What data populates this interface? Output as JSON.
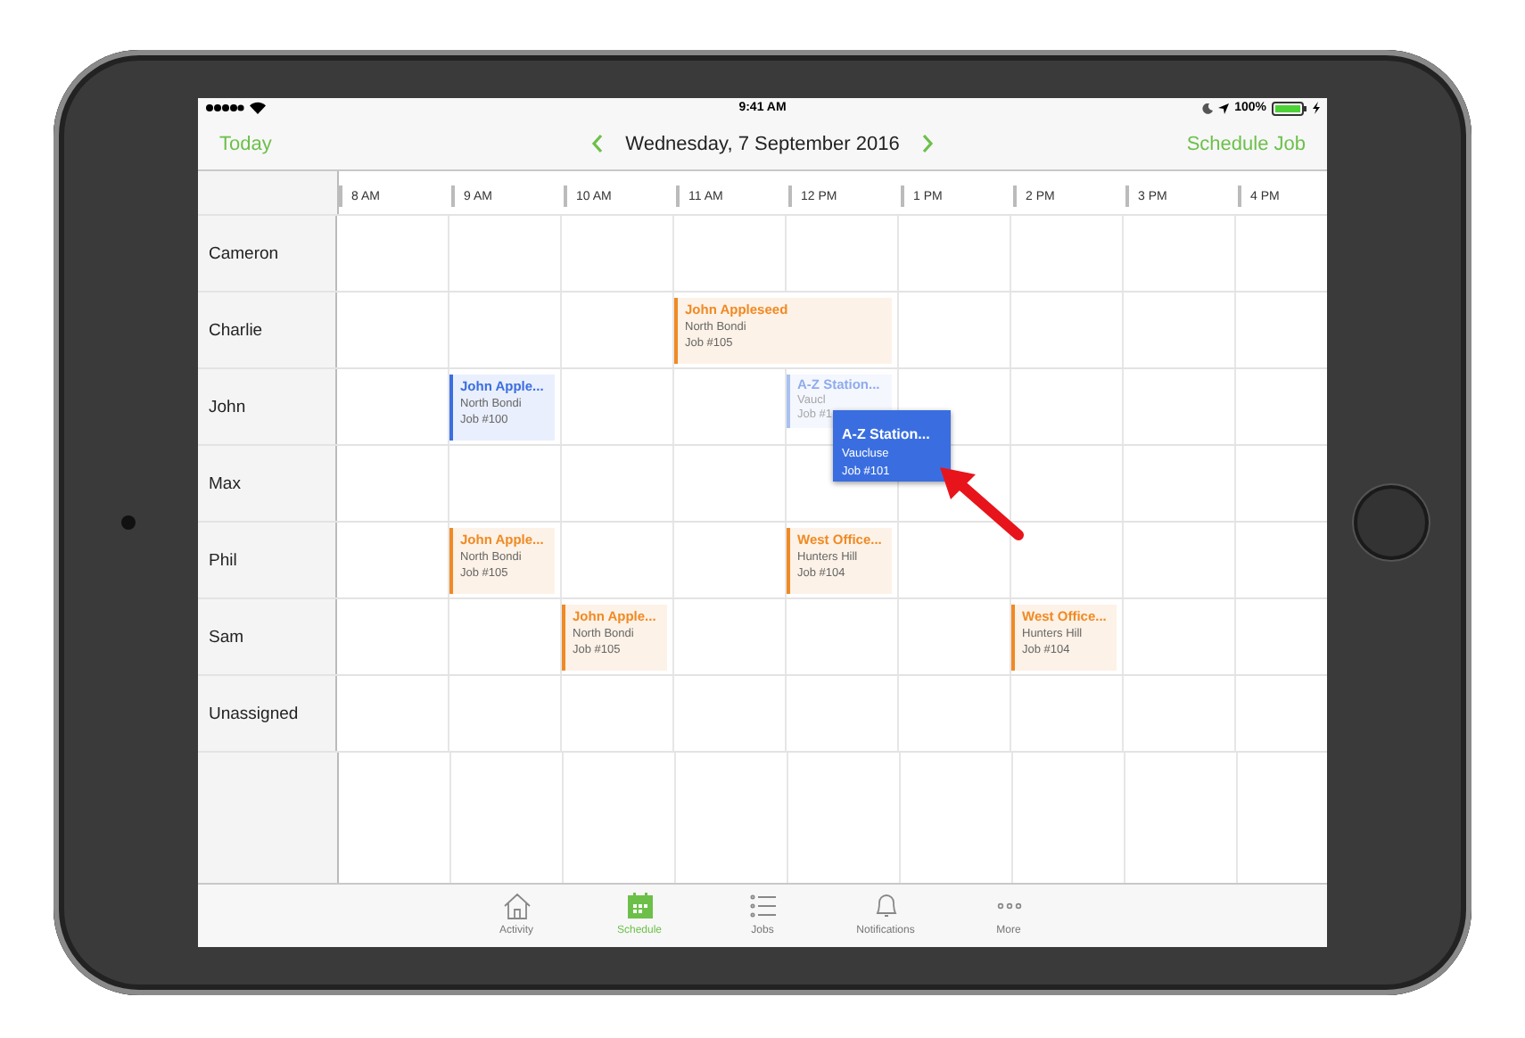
{
  "status_bar": {
    "time": "9:41 AM",
    "battery": "100%"
  },
  "nav": {
    "left": "Today",
    "title": "Wednesday, 7 September 2016",
    "right": "Schedule Job"
  },
  "hours": [
    "8 AM",
    "9 AM",
    "10 AM",
    "11 AM",
    "12 PM",
    "1 PM",
    "2 PM",
    "3 PM",
    "4 PM"
  ],
  "rows": [
    {
      "name": "Cameron",
      "slots": [
        {
          "kind": "empty"
        },
        {
          "kind": "empty"
        },
        {
          "kind": "empty"
        },
        {
          "kind": "empty"
        },
        {
          "kind": "empty"
        },
        {
          "kind": "empty"
        },
        {
          "kind": "empty"
        },
        {
          "kind": "empty"
        },
        {
          "kind": "empty"
        }
      ]
    },
    {
      "name": "Charlie",
      "slots": [
        {
          "kind": "empty"
        },
        {
          "kind": "empty"
        },
        {
          "kind": "empty"
        },
        {
          "kind": "wide_job",
          "title": "John Appleseed",
          "place": "North Bondi",
          "number": "Job #105",
          "color": "#f08a24",
          "ghost": false
        },
        {
          "kind": "empty"
        },
        {
          "kind": "empty"
        },
        {
          "kind": "empty"
        }
      ]
    },
    {
      "name": "John",
      "slots": [
        {
          "kind": "empty"
        },
        {
          "kind": "job",
          "title": "John Apple...",
          "place": "North Bondi",
          "number": "Job #100",
          "color": "#3b6ee0",
          "ghost": false
        },
        {
          "kind": "empty"
        },
        {
          "kind": "empty"
        },
        {
          "kind": "job",
          "title": "A-Z Station...",
          "place": "Vaucl",
          "number": "Job #1",
          "color": "#a9c0f0",
          "ghost": true
        },
        {
          "kind": "empty"
        },
        {
          "kind": "empty"
        },
        {
          "kind": "empty"
        },
        {
          "kind": "empty"
        }
      ]
    },
    {
      "name": "Max",
      "slots": [
        {
          "kind": "empty"
        },
        {
          "kind": "empty"
        },
        {
          "kind": "empty"
        },
        {
          "kind": "empty"
        },
        {
          "kind": "empty"
        },
        {
          "kind": "empty"
        },
        {
          "kind": "empty"
        },
        {
          "kind": "empty"
        },
        {
          "kind": "empty"
        }
      ]
    },
    {
      "name": "Phil",
      "slots": [
        {
          "kind": "empty"
        },
        {
          "kind": "job",
          "title": "John Apple...",
          "place": "North Bondi",
          "number": "Job #105",
          "color": "#f08a24",
          "ghost": false
        },
        {
          "kind": "empty"
        },
        {
          "kind": "empty"
        },
        {
          "kind": "job",
          "title": "West Office...",
          "place": "Hunters Hill",
          "number": "Job #104",
          "color": "#f08a24",
          "ghost": false
        },
        {
          "kind": "empty"
        },
        {
          "kind": "empty"
        },
        {
          "kind": "empty"
        },
        {
          "kind": "empty"
        }
      ]
    },
    {
      "name": "Sam",
      "slots": [
        {
          "kind": "empty"
        },
        {
          "kind": "empty"
        },
        {
          "kind": "job",
          "title": "John Apple...",
          "place": "North Bondi",
          "number": "Job #105",
          "color": "#f08a24",
          "ghost": false
        },
        {
          "kind": "empty"
        },
        {
          "kind": "empty"
        },
        {
          "kind": "empty"
        },
        {
          "kind": "job",
          "title": "West Office...",
          "place": "Hunters Hill",
          "number": "Job #104",
          "color": "#f08a24",
          "ghost": false
        },
        {
          "kind": "empty"
        },
        {
          "kind": "empty"
        }
      ]
    },
    {
      "name": "Unassigned",
      "slots": [
        {
          "kind": "empty"
        },
        {
          "kind": "empty"
        },
        {
          "kind": "empty"
        },
        {
          "kind": "empty"
        },
        {
          "kind": "empty"
        },
        {
          "kind": "empty"
        },
        {
          "kind": "empty"
        },
        {
          "kind": "empty"
        },
        {
          "kind": "empty"
        }
      ]
    }
  ],
  "dragged_job": {
    "title": "A-Z Station...",
    "place": "Vaucluse",
    "number": "Job #101"
  },
  "tabs": [
    {
      "label": "Activity",
      "kind": "house",
      "selected": false
    },
    {
      "label": "Schedule",
      "kind": "calendar",
      "selected": true
    },
    {
      "label": "Jobs",
      "kind": "list",
      "selected": false
    },
    {
      "label": "Notifications",
      "kind": "bell",
      "selected": false
    },
    {
      "label": "More",
      "kind": "dots",
      "selected": false
    }
  ]
}
